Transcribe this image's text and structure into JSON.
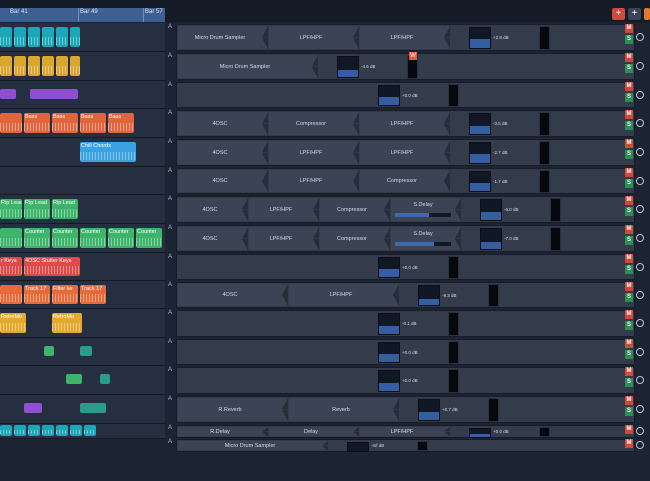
{
  "ruler": {
    "bar_labels": [
      "Bar 41",
      "Bar 49",
      "Bar 57"
    ]
  },
  "toolbar": {
    "add_track_label": "+",
    "add_label": "+"
  },
  "colors": {
    "accent": "#3d5f91",
    "mute": "#d2483a",
    "solo": "#2d8f53",
    "warn": "#e8583c"
  },
  "lanes": [
    {
      "clips": [
        {
          "label": "",
          "color": "#1aa7b8"
        },
        {
          "label": "",
          "color": "#1aa7b8"
        },
        {
          "label": "",
          "color": "#1aa7b8"
        },
        {
          "label": "",
          "color": "#1aa7b8"
        },
        {
          "label": "",
          "color": "#1aa7b8"
        },
        {
          "label": "",
          "color": "#1aa7b8"
        },
        {
          "label": "",
          "color": "#1aa7b8"
        }
      ]
    },
    {
      "clips": [
        {
          "label": "",
          "color": "#d9a62e"
        },
        {
          "label": "",
          "color": "#d9a62e"
        },
        {
          "label": "",
          "color": "#d9a62e"
        },
        {
          "label": "",
          "color": "#d9a62e"
        },
        {
          "label": "",
          "color": "#d9a62e"
        },
        {
          "label": "",
          "color": "#d9a62e"
        },
        {
          "label": "",
          "color": "#d9a62e"
        }
      ]
    },
    {
      "clips": []
    },
    {
      "clips": [
        {
          "label": "",
          "color": "#e0663e"
        },
        {
          "label": "Bass",
          "color": "#e0663e"
        },
        {
          "label": "Bass",
          "color": "#e0663e"
        },
        {
          "label": "Bass",
          "color": "#e0663e"
        },
        {
          "label": "Bass",
          "color": "#e0663e"
        }
      ]
    },
    {
      "clips": [
        {
          "label": "Chill Chords",
          "color": "#3aa2e0"
        }
      ]
    },
    {
      "clips": []
    },
    {
      "clips": [
        {
          "label": "Rip Lead",
          "color": "#3db46a"
        },
        {
          "label": "Rip Lead",
          "color": "#3db46a"
        },
        {
          "label": "Rip Lead",
          "color": "#3db46a"
        }
      ]
    },
    {
      "clips": [
        {
          "label": "",
          "color": "#3db46a"
        },
        {
          "label": "Counter",
          "color": "#3db46a"
        },
        {
          "label": "Counter",
          "color": "#3db46a"
        },
        {
          "label": "Counter",
          "color": "#3db46a"
        },
        {
          "label": "Counter",
          "color": "#3db46a"
        },
        {
          "label": "Counter",
          "color": "#3db46a"
        }
      ]
    },
    {
      "clips": [
        {
          "label": "r Keys",
          "color": "#dd4a4a"
        },
        {
          "label": "4OSC Stutter Keys",
          "color": "#dd4a4a"
        }
      ]
    },
    {
      "clips": [
        {
          "label": "",
          "color": "#e66a3a"
        },
        {
          "label": "Track 17",
          "color": "#e66a3a"
        },
        {
          "label": "Filter ke",
          "color": "#e66a3a"
        },
        {
          "label": "Track 17",
          "color": "#e66a3a"
        }
      ]
    },
    {
      "clips": [
        {
          "label": "RetroMo",
          "color": "#e4aa30"
        },
        {
          "label": "RetroMo",
          "color": "#e4aa30"
        }
      ]
    },
    {
      "clips": []
    },
    {
      "clips": []
    },
    {
      "clips": []
    },
    {
      "clips": [
        {
          "label": "",
          "color": "#1aa7b8"
        },
        {
          "label": "",
          "color": "#1aa7b8"
        },
        {
          "label": "",
          "color": "#1aa7b8"
        },
        {
          "label": "",
          "color": "#1aa7b8"
        },
        {
          "label": "",
          "color": "#1aa7b8"
        },
        {
          "label": "",
          "color": "#1aa7b8"
        },
        {
          "label": "",
          "color": "#1aa7b8"
        }
      ]
    }
  ],
  "strips": [
    {
      "auto": "A",
      "plugins": [
        "Micro Drum Sampler",
        "LPF/HPF",
        "LPF/HPF"
      ],
      "db": "+2.8 dB",
      "level": 0.45,
      "mute": "M",
      "solo": "S"
    },
    {
      "auto": "A",
      "plugins": [
        "Micro Drum Sampler"
      ],
      "db": "-4.6 dB",
      "level": 0.35,
      "mute": "M",
      "solo": "S",
      "warn": "W"
    },
    {
      "auto": "A",
      "plugins": [],
      "db": "+0.0 dB",
      "level": 0.4,
      "mute": "M",
      "solo": "S"
    },
    {
      "auto": "A",
      "plugins": [
        "4OSC",
        "Compressor",
        "LPF/HPF"
      ],
      "db": "-3.5 dB",
      "level": 0.42,
      "mute": "M",
      "solo": "S"
    },
    {
      "auto": "A",
      "plugins": [
        "4OSC",
        "LPF/HPF",
        "LPF/HPF"
      ],
      "db": "-2.7 dB",
      "level": 0.43,
      "mute": "M",
      "solo": "S"
    },
    {
      "auto": "A",
      "plugins": [
        "4OSC",
        "LPF/HPF",
        "Compressor"
      ],
      "db": "-1.7 dB",
      "level": 0.44,
      "mute": "M",
      "solo": "S"
    },
    {
      "auto": "A",
      "plugins": [
        "4OSC",
        "LPF/HPF",
        "Compressor",
        "S.Delay"
      ],
      "db": "-6.0 dB",
      "level": 0.38,
      "mute": "M",
      "solo": "S",
      "send": 0.6
    },
    {
      "auto": "A",
      "plugins": [
        "4OSC",
        "LPF/HPF",
        "Compressor",
        "S.Delay"
      ],
      "db": "-7.0 dB",
      "level": 0.37,
      "mute": "M",
      "solo": "S",
      "send": 0.7
    },
    {
      "auto": "A",
      "plugins": [],
      "db": "+0.0 dB",
      "level": 0.4,
      "mute": "M",
      "solo": "S"
    },
    {
      "auto": "A",
      "plugins": [
        "4OSC",
        "LPF/HPF"
      ],
      "db": "-9.3 dB",
      "level": 0.33,
      "mute": "M",
      "solo": "S"
    },
    {
      "auto": "A",
      "plugins": [],
      "db": "-0.1 dB",
      "level": 0.4,
      "mute": "M",
      "solo": "S"
    },
    {
      "auto": "A",
      "plugins": [],
      "db": "+0.0 dB",
      "level": 0.4,
      "mute": "M",
      "solo": "S"
    },
    {
      "auto": "A",
      "plugins": [],
      "db": "+0.0 dB",
      "level": 0.4,
      "mute": "M",
      "solo": "S"
    },
    {
      "auto": "A",
      "plugins": [
        "R.Reverb",
        "Reverb"
      ],
      "db": "+0.7 dB",
      "level": 0.42,
      "mute": "M",
      "solo": "S"
    },
    {
      "auto": "A",
      "plugins": [
        "R.Delay",
        "Delay",
        "LPF/HPF"
      ],
      "db": "+0.0 dB",
      "level": 0.4,
      "mute": "M",
      "solo": "S"
    },
    {
      "auto": "A",
      "plugins": [
        "Micro Drum Sampler"
      ],
      "db": "-Inf dB",
      "level": 0.0,
      "mute": "M",
      "solo": "S"
    }
  ]
}
